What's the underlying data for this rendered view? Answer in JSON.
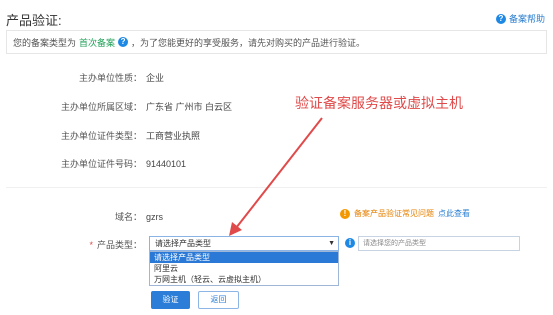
{
  "header": {
    "title": "产品验证:",
    "help_label": "备案帮助"
  },
  "notice": {
    "prefix": "您的备案类型为",
    "type": "首次备案",
    "suffix": "，为了您能更好的享受服务，请先对购买的产品进行验证。"
  },
  "info_rows": [
    {
      "label": "主办单位性质：",
      "value": "企业"
    },
    {
      "label": "主办单位所属区域：",
      "value": "广东省 广州市 白云区"
    },
    {
      "label": "主办单位证件类型：",
      "value": "工商营业执照"
    },
    {
      "label": "主办单位证件号码：",
      "value": "91440101"
    }
  ],
  "annotation": {
    "text": "验证备案服务器或虚拟主机",
    "color": "#e04a4a"
  },
  "domain_row": {
    "label": "域名：",
    "value": "gzrs"
  },
  "warning": {
    "text": "备案产品验证常见问题",
    "link": "点此查看"
  },
  "product_type": {
    "required_mark": "*",
    "label": "产品类型：",
    "selected": "请选择产品类型",
    "options": [
      "请选择产品类型",
      "阿里云",
      "万网主机（轻云、云虚拟主机）"
    ],
    "hint_placeholder": "请选择您的产品类型"
  },
  "actions": {
    "verify_label": "验证",
    "back_label": "返回"
  },
  "colors": {
    "accent": "#2b7dd8",
    "warning": "#f39800",
    "annotation": "#e04a4a"
  }
}
